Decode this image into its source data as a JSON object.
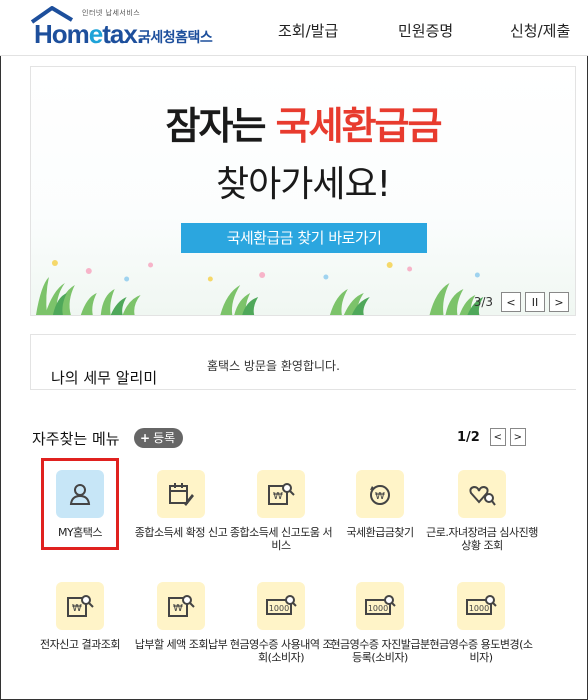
{
  "header": {
    "logo_tagline": "인터넷 납세서비스",
    "logo_brand_a": "Hom",
    "logo_brand_e": "e",
    "logo_brand_b": "tax.",
    "logo_service": "국세청홈택스",
    "nav": [
      "조회/발급",
      "민원증명",
      "신청/제출"
    ]
  },
  "banner": {
    "title_a": "잠자는 ",
    "title_b": "국세환급금",
    "subtitle": "찾아가세요!",
    "button": "국세환급금 찾기 바로가기",
    "pager": "3/3",
    "prev": "<",
    "pause": "II",
    "next": ">"
  },
  "notice": {
    "title": "나의 세무 알리미",
    "message": "홈택스 방문을 환영합니다."
  },
  "favorites": {
    "title": "자주찾는 메뉴",
    "register": "등록",
    "page": "1/2",
    "prev": "<",
    "next": ">",
    "items": [
      {
        "label": "MY홈택스",
        "icon": "user-icon"
      },
      {
        "label": "종합소득세 확정 신고",
        "icon": "calendar-edit-icon"
      },
      {
        "label": "종합소득세 신고도움 서비스",
        "icon": "document-search-icon"
      },
      {
        "label": "국세환급금찾기",
        "icon": "refund-coin-icon"
      },
      {
        "label": "근로.자녀장려금 심사진행상황 조회",
        "icon": "heart-hand-icon"
      },
      {
        "label": "전자신고 결과조회",
        "icon": "document-search-icon"
      },
      {
        "label": "납부할 세액 조회납부",
        "icon": "document-search-icon"
      },
      {
        "label": "현금영수증 사용내역 조회(소비자)",
        "icon": "receipt-search-icon"
      },
      {
        "label": "현금영수증 자진발급분 등록(소비자)",
        "icon": "receipt-search-icon"
      },
      {
        "label": "현금영수증 용도변경(소비자)",
        "icon": "receipt-search-icon"
      }
    ]
  },
  "colors": {
    "brand_blue": "#1d4f9c",
    "accent_red": "#e83b2e",
    "button_blue": "#2ba6df",
    "icon_bg_yellow": "#fff4c8",
    "icon_bg_blue": "#c7e6f7",
    "highlight_red": "#e0211f"
  }
}
